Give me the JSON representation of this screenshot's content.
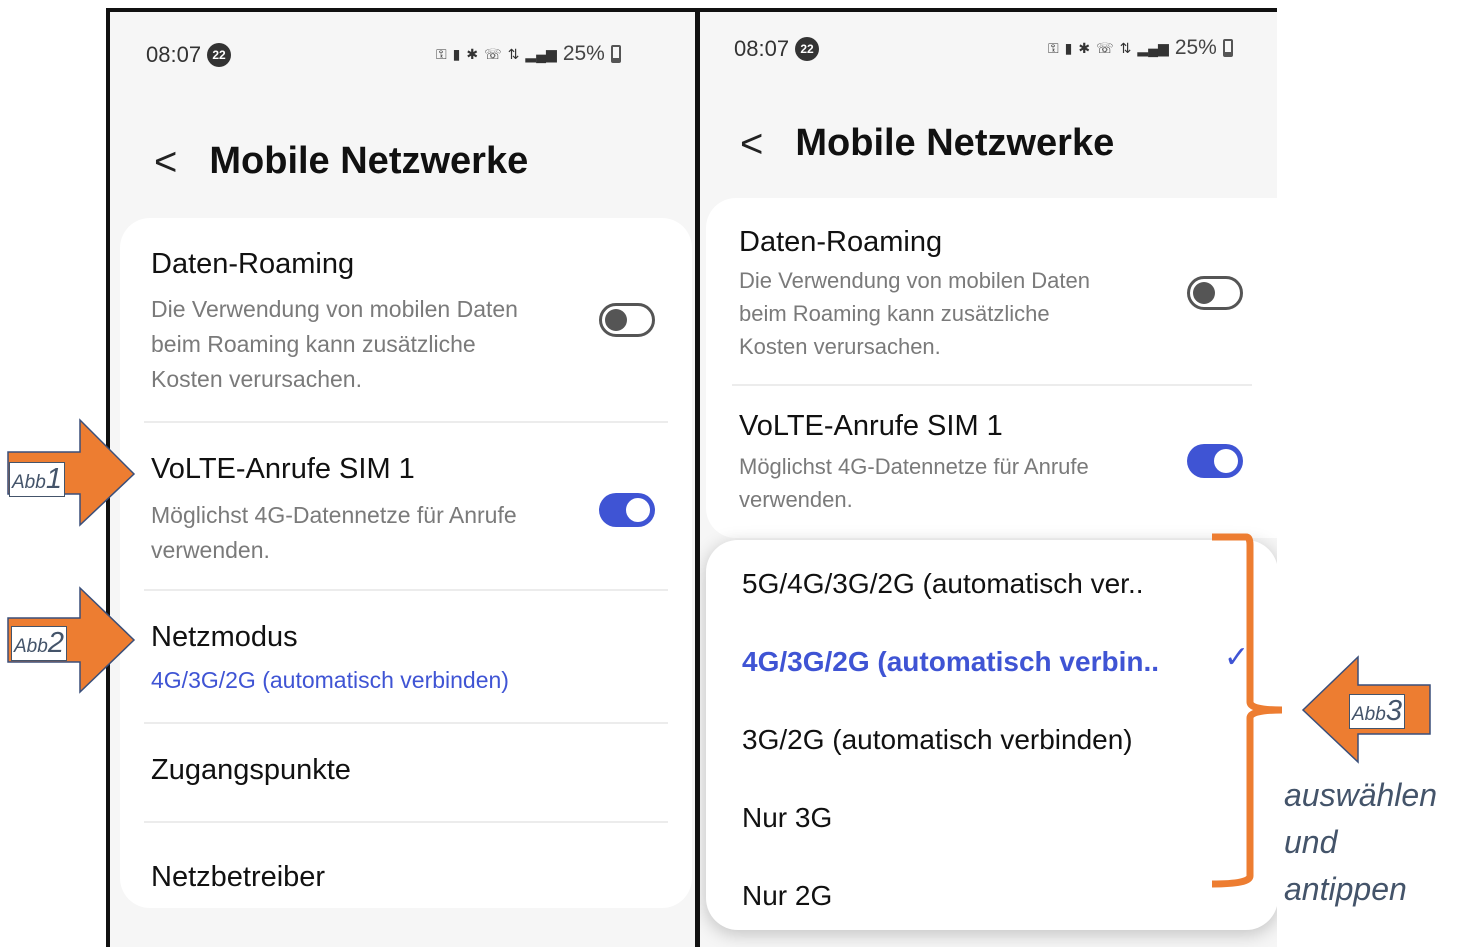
{
  "left_screen": {
    "status": {
      "time": "08:07",
      "notif_count": "22",
      "battery": "25%"
    },
    "title": "Mobile Netzwerke",
    "rows": [
      {
        "title": "Daten-Roaming",
        "subtitle_lines": [
          "Die Verwendung von mobilen Daten",
          "beim Roaming kann zusätzliche",
          "Kosten verursachen."
        ],
        "toggle": "off"
      },
      {
        "title": "VoLTE-Anrufe SIM 1",
        "subtitle_lines": [
          "Möglichst 4G-Datennetze für Anrufe",
          "verwenden."
        ],
        "toggle": "on"
      },
      {
        "title": "Netzmodus",
        "value": "4G/3G/2G (automatisch verbinden)"
      },
      {
        "title": "Zugangspunkte"
      },
      {
        "title": "Netzbetreiber"
      }
    ]
  },
  "right_screen": {
    "status": {
      "time": "08:07",
      "notif_count": "22",
      "battery": "25%"
    },
    "title": "Mobile Netzwerke",
    "rows": [
      {
        "title": "Daten-Roaming",
        "subtitle_lines": [
          "Die Verwendung von mobilen Daten",
          "beim Roaming kann zusätzliche",
          "Kosten verursachen."
        ],
        "toggle": "off"
      },
      {
        "title": "VoLTE-Anrufe SIM 1",
        "subtitle_lines": [
          "Möglichst 4G-Datennetze für Anrufe",
          "verwenden."
        ],
        "toggle": "on"
      }
    ],
    "network_mode_options": [
      {
        "label": "5G/4G/3G/2G (automatisch ver..",
        "selected": false
      },
      {
        "label": "4G/3G/2G (automatisch verbin..",
        "selected": true
      },
      {
        "label": "3G/2G (automatisch verbinden)",
        "selected": false
      },
      {
        "label": "Nur 3G",
        "selected": false
      },
      {
        "label": "Nur 2G",
        "selected": false
      }
    ]
  },
  "annotations": {
    "abb1": {
      "prefix": "Abb",
      "number": "1"
    },
    "abb2": {
      "prefix": "Abb",
      "number": "2"
    },
    "abb3": {
      "prefix": "Abb",
      "number": "3"
    },
    "instruction_lines": [
      "auswählen",
      "und",
      "antippen"
    ]
  },
  "colors": {
    "accent": "#3f54d4",
    "annotation_orange": "#ed7d31",
    "annotation_text": "#44546a"
  }
}
